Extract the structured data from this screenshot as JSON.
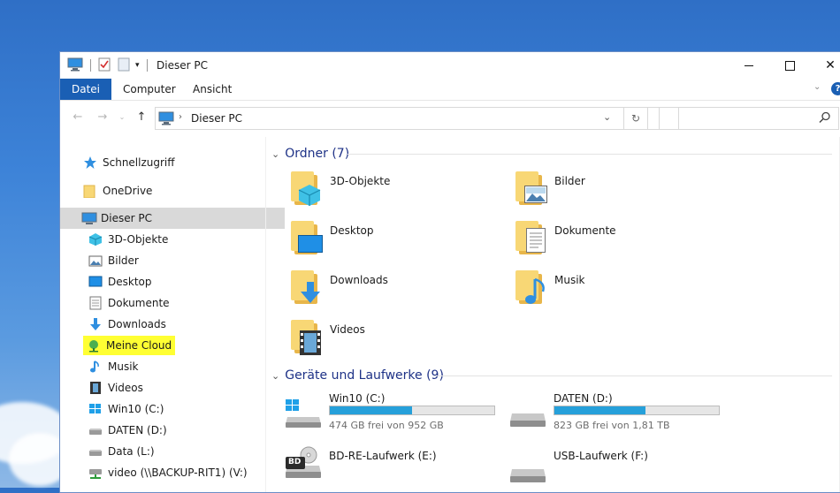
{
  "window": {
    "title": "Dieser PC"
  },
  "ribbon": {
    "tabs": [
      {
        "label": "Datei",
        "active": true
      },
      {
        "label": "Computer",
        "active": false
      },
      {
        "label": "Ansicht",
        "active": false
      }
    ]
  },
  "address": {
    "path": "Dieser PC"
  },
  "nav": {
    "items": [
      {
        "label": "Schnellzugriff",
        "icon": "star-icon"
      },
      {
        "label": "OneDrive",
        "icon": "folder-icon"
      },
      {
        "label": "Dieser PC",
        "icon": "pc-icon",
        "selected": true
      },
      {
        "label": "3D-Objekte",
        "icon": "cube-icon"
      },
      {
        "label": "Bilder",
        "icon": "picture-icon"
      },
      {
        "label": "Desktop",
        "icon": "desktop-icon"
      },
      {
        "label": "Dokumente",
        "icon": "document-icon"
      },
      {
        "label": "Downloads",
        "icon": "download-icon"
      },
      {
        "label": "Meine Cloud",
        "icon": "cloud-drive-icon",
        "highlighted": true
      },
      {
        "label": "Musik",
        "icon": "music-icon"
      },
      {
        "label": "Videos",
        "icon": "video-icon"
      },
      {
        "label": "Win10 (C:)",
        "icon": "windows-drive-icon"
      },
      {
        "label": "DATEN (D:)",
        "icon": "drive-icon"
      },
      {
        "label": "Data (L:)",
        "icon": "drive-icon"
      },
      {
        "label": "video (\\\\BACKUP-RIT1) (V:)",
        "icon": "network-drive-icon"
      }
    ]
  },
  "content": {
    "folders_header": "Ordner (7)",
    "folders": [
      {
        "label": "3D-Objekte",
        "icon": "cube-icon"
      },
      {
        "label": "Bilder",
        "icon": "picture-icon"
      },
      {
        "label": "Desktop",
        "icon": "desktop-icon"
      },
      {
        "label": "Dokumente",
        "icon": "document-icon"
      },
      {
        "label": "Downloads",
        "icon": "download-icon"
      },
      {
        "label": "Musik",
        "icon": "music-icon"
      },
      {
        "label": "Videos",
        "icon": "video-icon"
      }
    ],
    "drives_header": "Geräte und Laufwerke (9)",
    "drives": [
      {
        "label": "Win10 (C:)",
        "free_text": "474 GB frei von 952 GB",
        "used_fraction": 0.502,
        "icon": "windows-drive-icon"
      },
      {
        "label": "DATEN (D:)",
        "free_text": "823 GB frei von 1,81 TB",
        "used_fraction": 0.556,
        "icon": "drive-icon"
      },
      {
        "label": "BD-RE-Laufwerk (E:)",
        "icon": "bd-drive-icon",
        "badge": "BD"
      },
      {
        "label": "USB-Laufwerk (F:)",
        "icon": "drive-icon"
      }
    ]
  },
  "colors": {
    "accent": "#1a5fb4",
    "group_header": "#1e3287",
    "bar_fill": "#26a0da",
    "highlight": "#ffff33"
  }
}
